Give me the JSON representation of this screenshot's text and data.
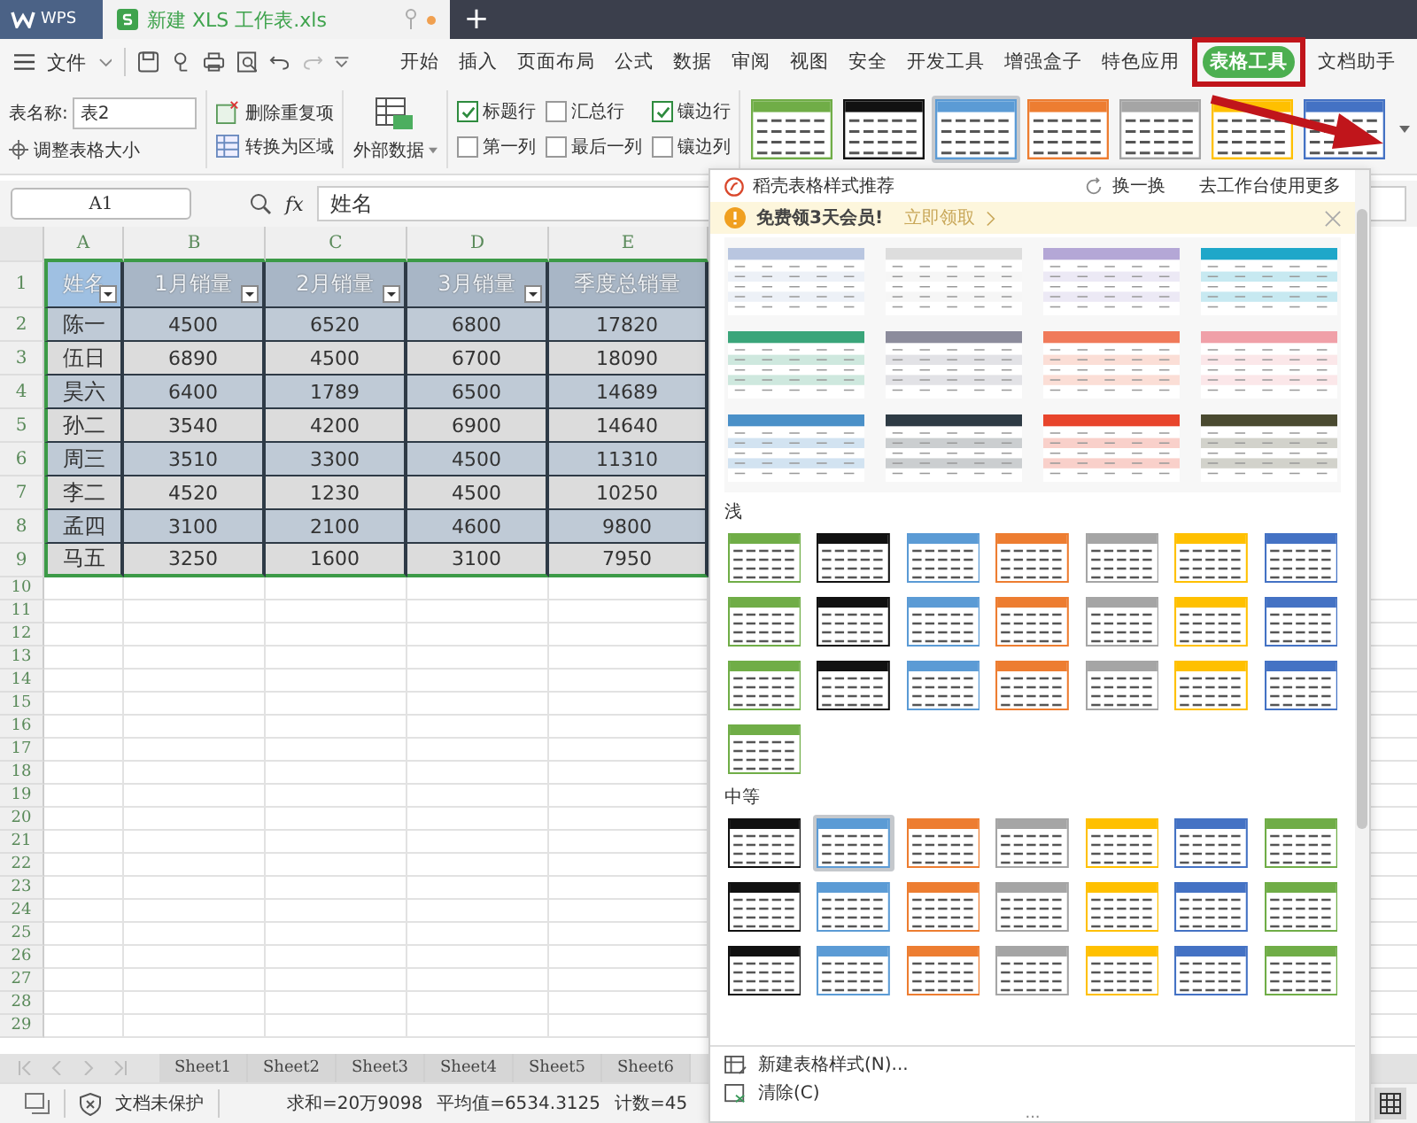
{
  "title_bar": {
    "app_tab": "WPS",
    "doc_tab": "新建 XLS 工作表.xls",
    "new_tab": "+"
  },
  "menu": {
    "file": "文件",
    "tabs": [
      {
        "label": "开始",
        "selected": false
      },
      {
        "label": "插入",
        "selected": false
      },
      {
        "label": "页面布局",
        "selected": false
      },
      {
        "label": "公式",
        "selected": false
      },
      {
        "label": "数据",
        "selected": false
      },
      {
        "label": "审阅",
        "selected": false
      },
      {
        "label": "视图",
        "selected": false
      },
      {
        "label": "安全",
        "selected": false
      },
      {
        "label": "开发工具",
        "selected": false
      },
      {
        "label": "增强盒子",
        "selected": false
      },
      {
        "label": "特色应用",
        "selected": false
      },
      {
        "label": "表格工具",
        "selected": true
      },
      {
        "label": "文档助手",
        "selected": false
      }
    ]
  },
  "ribbon": {
    "table_name_label": "表名称:",
    "table_name": "表2",
    "resize": "调整表格大小",
    "remove_duplicates": "删除重复项",
    "convert_to_range": "转换为区域",
    "external_data": "外部数据",
    "options": [
      {
        "label": "标题行",
        "checked": true
      },
      {
        "label": "汇总行",
        "checked": false
      },
      {
        "label": "镶边行",
        "checked": true
      },
      {
        "label": "第一列",
        "checked": false
      },
      {
        "label": "最后一列",
        "checked": false
      },
      {
        "label": "镶边列",
        "checked": false
      }
    ],
    "styles": [
      {
        "color": "#70ad47",
        "selected": false
      },
      {
        "color": "#111111",
        "selected": false
      },
      {
        "color": "#5b9bd5",
        "selected": true
      },
      {
        "color": "#ed7d31",
        "selected": false
      },
      {
        "color": "#a5a5a5",
        "selected": false
      },
      {
        "color": "#ffc000",
        "selected": false
      },
      {
        "color": "#4472c4",
        "selected": false
      }
    ]
  },
  "formula_bar": {
    "cell": "A1",
    "fx": "fx",
    "value": "姓名"
  },
  "sheet": {
    "columns": [
      "A",
      "B",
      "C",
      "D",
      "E"
    ],
    "header_row": "1",
    "headers": [
      "姓名",
      "1月销量",
      "2月销量",
      "3月销量",
      "季度总销量"
    ],
    "rows": [
      {
        "num": "2",
        "cells": [
          "陈一",
          "4500",
          "6520",
          "6800",
          "17820"
        ]
      },
      {
        "num": "3",
        "cells": [
          "伍日",
          "6890",
          "4500",
          "6700",
          "18090"
        ]
      },
      {
        "num": "4",
        "cells": [
          "昊六",
          "6400",
          "1789",
          "6500",
          "14689"
        ]
      },
      {
        "num": "5",
        "cells": [
          "孙二",
          "3540",
          "4200",
          "6900",
          "14640"
        ]
      },
      {
        "num": "6",
        "cells": [
          "周三",
          "3510",
          "3300",
          "4500",
          "11310"
        ]
      },
      {
        "num": "7",
        "cells": [
          "李二",
          "4520",
          "1230",
          "4500",
          "10250"
        ]
      },
      {
        "num": "8",
        "cells": [
          "孟四",
          "3100",
          "2100",
          "4600",
          "9800"
        ]
      },
      {
        "num": "9",
        "cells": [
          "马五",
          "3250",
          "1600",
          "3100",
          "7950"
        ]
      }
    ],
    "empty_rows": [
      "10",
      "11",
      "12",
      "13",
      "14",
      "15",
      "16",
      "17",
      "18",
      "19",
      "20",
      "21",
      "22",
      "23",
      "24",
      "25",
      "26",
      "27",
      "28",
      "29"
    ]
  },
  "sheet_tabs": [
    "Sheet1",
    "Sheet2",
    "Sheet3",
    "Sheet4",
    "Sheet5",
    "Sheet6"
  ],
  "status_bar": {
    "protection": "文档未保护",
    "sum": "求和=20万9098",
    "average": "平均值=6534.3125",
    "count": "计数=45"
  },
  "style_panel": {
    "title": "稻壳表格样式推荐",
    "refresh": "换一换",
    "more": "去工作台使用更多",
    "promo": {
      "text": "免费领3天会员!",
      "link": "立即领取"
    },
    "recommended": [
      {
        "color": "#b9c6e0"
      },
      {
        "color": "#dddddd"
      },
      {
        "color": "#b4a7d6"
      },
      {
        "color": "#1fa7c9"
      },
      {
        "color": "#3aa57a"
      },
      {
        "color": "#8c8c9c"
      },
      {
        "color": "#f07a5a"
      },
      {
        "color": "#f0a0a8"
      },
      {
        "color": "#4a90c8"
      },
      {
        "color": "#2e3b45"
      },
      {
        "color": "#e8452c"
      },
      {
        "color": "#4a4a30"
      }
    ],
    "sections": [
      {
        "title": "浅",
        "styles": [
          {
            "color": "#70ad47",
            "selected": false
          },
          {
            "color": "#111111",
            "selected": false
          },
          {
            "color": "#5b9bd5",
            "selected": false
          },
          {
            "color": "#ed7d31",
            "selected": false
          },
          {
            "color": "#a5a5a5",
            "selected": false
          },
          {
            "color": "#ffc000",
            "selected": false
          },
          {
            "color": "#4472c4",
            "selected": false
          },
          {
            "color": "#70ad47",
            "selected": false
          },
          {
            "color": "#111111",
            "selected": false
          },
          {
            "color": "#5b9bd5",
            "selected": false
          },
          {
            "color": "#ed7d31",
            "selected": false
          },
          {
            "color": "#a5a5a5",
            "selected": false
          },
          {
            "color": "#ffc000",
            "selected": false
          },
          {
            "color": "#4472c4",
            "selected": false
          },
          {
            "color": "#70ad47",
            "selected": false
          },
          {
            "color": "#111111",
            "selected": false
          },
          {
            "color": "#5b9bd5",
            "selected": false
          },
          {
            "color": "#ed7d31",
            "selected": false
          },
          {
            "color": "#a5a5a5",
            "selected": false
          },
          {
            "color": "#ffc000",
            "selected": false
          },
          {
            "color": "#4472c4",
            "selected": false
          },
          {
            "color": "#70ad47",
            "selected": false
          }
        ]
      },
      {
        "title": "中等",
        "styles": [
          {
            "color": "#111111",
            "selected": false
          },
          {
            "color": "#5b9bd5",
            "selected": true
          },
          {
            "color": "#ed7d31",
            "selected": false
          },
          {
            "color": "#a5a5a5",
            "selected": false
          },
          {
            "color": "#ffc000",
            "selected": false
          },
          {
            "color": "#4472c4",
            "selected": false
          },
          {
            "color": "#70ad47",
            "selected": false
          },
          {
            "color": "#111111",
            "selected": false
          },
          {
            "color": "#5b9bd5",
            "selected": false
          },
          {
            "color": "#ed7d31",
            "selected": false
          },
          {
            "color": "#a5a5a5",
            "selected": false
          },
          {
            "color": "#ffc000",
            "selected": false
          },
          {
            "color": "#4472c4",
            "selected": false
          },
          {
            "color": "#70ad47",
            "selected": false
          },
          {
            "color": "#111111",
            "selected": false
          },
          {
            "color": "#5b9bd5",
            "selected": false
          },
          {
            "color": "#ed7d31",
            "selected": false
          },
          {
            "color": "#a5a5a5",
            "selected": false
          },
          {
            "color": "#ffc000",
            "selected": false
          },
          {
            "color": "#4472c4",
            "selected": false
          },
          {
            "color": "#70ad47",
            "selected": false
          }
        ]
      }
    ],
    "actions": [
      "新建表格样式(N)...",
      "清除(C)"
    ],
    "footer": "..."
  }
}
